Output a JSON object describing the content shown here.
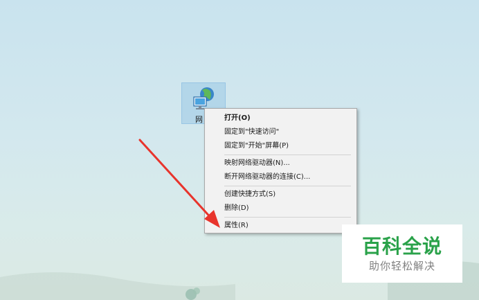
{
  "desktop_icon": {
    "label": "网",
    "icon": "network-globe-icon"
  },
  "context_menu": {
    "groups": [
      [
        "打开(O)",
        "固定到\"快速访问\"",
        "固定到\"开始\"屏幕(P)"
      ],
      [
        "映射网络驱动器(N)...",
        "断开网络驱动器的连接(C)..."
      ],
      [
        "创建快捷方式(S)",
        "删除(D)"
      ],
      [
        "属性(R)"
      ]
    ]
  },
  "watermark": {
    "brand": "百科全说",
    "tagline": "助你轻松解决"
  },
  "colors": {
    "arrow": "#e8342c",
    "brand": "#2aa24a"
  }
}
